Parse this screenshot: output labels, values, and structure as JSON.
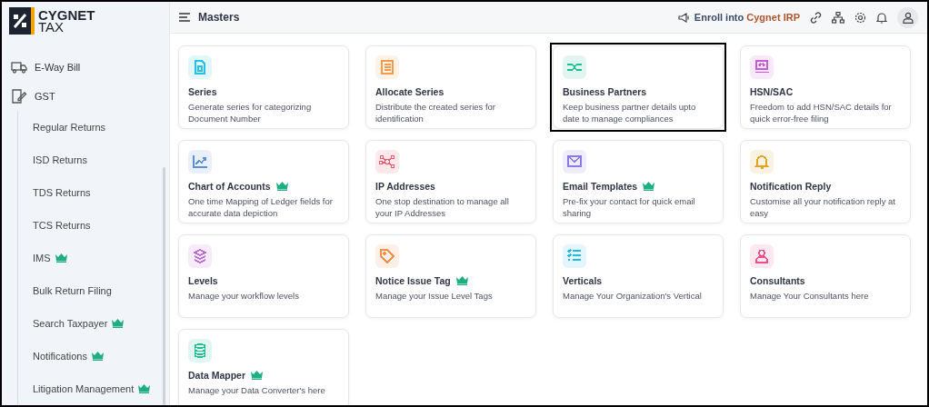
{
  "logo": {
    "line1": "CYGNET",
    "line2": "TAX"
  },
  "sidebar": {
    "items": [
      {
        "label": "E-Way Bill",
        "kind": "truck"
      },
      {
        "label": "GST",
        "kind": "document",
        "children": [
          {
            "label": "Regular Returns",
            "premium": false
          },
          {
            "label": "ISD Returns",
            "premium": false
          },
          {
            "label": "TDS Returns",
            "premium": false
          },
          {
            "label": "TCS Returns",
            "premium": false
          },
          {
            "label": "IMS",
            "premium": true
          },
          {
            "label": "Bulk Return Filing",
            "premium": false
          },
          {
            "label": "Search Taxpayer",
            "premium": true
          },
          {
            "label": "Notifications",
            "premium": true
          },
          {
            "label": "Litigation Management",
            "premium": true
          }
        ]
      }
    ]
  },
  "header": {
    "title": "Masters",
    "enroll": {
      "text": "Enroll into",
      "brand": "Cygnet IRP"
    }
  },
  "cards": [
    {
      "title": "Series",
      "description": "Generate series for categorizing Document Number",
      "kind": "document",
      "color": "#22c3e6",
      "premium": false,
      "highlighted": false
    },
    {
      "title": "Allocate Series",
      "description": "Distribute the created series for identification",
      "kind": "list",
      "color": "#f59a4a",
      "premium": false,
      "highlighted": false
    },
    {
      "title": "Business Partners",
      "description": "Keep business partner details upto date to manage compliances",
      "kind": "handshake",
      "color": "#1fbf8f",
      "premium": false,
      "highlighted": true
    },
    {
      "title": "HSN/SAC",
      "description": "Freedom to add HSN/SAC details for quick error-free filing",
      "kind": "monitor",
      "color": "#c75bd6",
      "premium": false,
      "highlighted": false
    },
    {
      "title": "Chart of Accounts",
      "description": "One time Mapping of Ledger fields for accurate data depiction",
      "kind": "chart",
      "color": "#5b8fd6",
      "premium": true,
      "highlighted": false
    },
    {
      "title": "IP Addresses",
      "description": "One stop destination to manage all your IP Addresses",
      "kind": "network",
      "color": "#f0566a",
      "premium": false,
      "highlighted": false
    },
    {
      "title": "Email Templates",
      "description": "Pre-fix your contact for quick email sharing",
      "kind": "mail",
      "color": "#8a7be8",
      "premium": true,
      "highlighted": false
    },
    {
      "title": "Notification Reply",
      "description": "Customise all your notification reply at easy",
      "kind": "bell",
      "color": "#e0a526",
      "premium": false,
      "highlighted": false
    },
    {
      "title": "Levels",
      "description": "Manage your workflow levels",
      "kind": "layers",
      "color": "#c06ad6",
      "premium": false,
      "highlighted": false
    },
    {
      "title": "Notice Issue Tag",
      "description": "Manage your Issue Level Tags",
      "kind": "tag",
      "color": "#f5904a",
      "premium": true,
      "highlighted": false
    },
    {
      "title": "Verticals",
      "description": "Manage Your Organization's Vertical",
      "kind": "checklist",
      "color": "#22b8e0",
      "premium": false,
      "highlighted": false
    },
    {
      "title": "Consultants",
      "description": "Manage Your Consultants here",
      "kind": "person",
      "color": "#ee4f8e",
      "premium": false,
      "highlighted": false
    },
    {
      "title": "Data Mapper",
      "description": "Manage your Data Converter's here",
      "kind": "database",
      "color": "#1fbf8f",
      "premium": true,
      "highlighted": false
    }
  ]
}
